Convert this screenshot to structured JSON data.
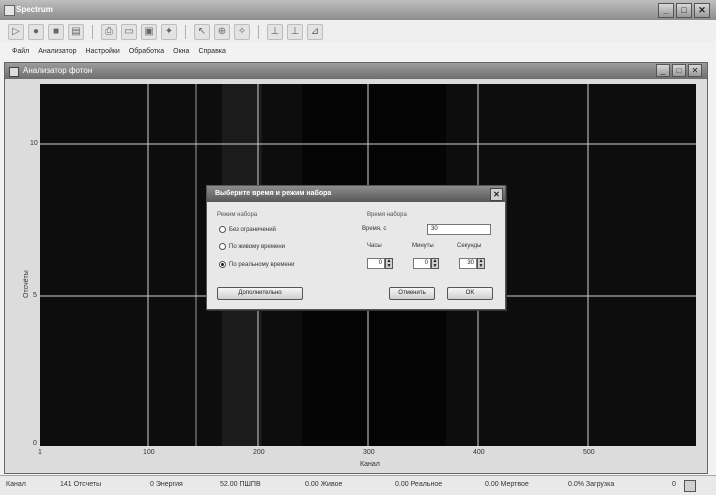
{
  "window": {
    "title": "Spectrum"
  },
  "menu": [
    "Файл",
    "Анализатор",
    "Настройки",
    "Обработка",
    "Окна",
    "Справка"
  ],
  "toolbar_icons": [
    "play-icon",
    "record-icon",
    "stop-icon",
    "save-icon",
    "print-icon",
    "folder-icon",
    "save-file-icon",
    "export-icon",
    "cursor-icon",
    "zoom-icon",
    "settings-icon",
    "marker-left-icon",
    "marker-center-icon",
    "marker-right-icon"
  ],
  "child_window": {
    "title": "Анализатор фотон"
  },
  "plot": {
    "y_ticks": [
      "10",
      "5",
      "0"
    ],
    "x_ticks": [
      "1",
      "100",
      "200",
      "300",
      "400",
      "500"
    ],
    "xlabel": "Канал",
    "ylabel": "Отсчёты"
  },
  "dialog": {
    "title": "Выберите время и режим набора",
    "mode_group": "Режим набора",
    "modes": [
      "Без ограничений",
      "По живому времени",
      "По реальному времени"
    ],
    "selected_mode": "По реальному времени",
    "time_group": "Время набора",
    "time_label": "Время, с",
    "time_value": "30",
    "hours_label": "Часы",
    "minutes_label": "Минуты",
    "seconds_label": "Секунды",
    "hours_value": "0",
    "minutes_value": "0",
    "seconds_value": "30",
    "advanced_button": "Дополнительно",
    "cancel_button": "Отменить",
    "ok_button": "OK"
  },
  "statusbar": {
    "channel": "Канал",
    "counts": "141 Отсчеты",
    "energy": "0 Энергия",
    "fwhm": "52.00 ПШПВ",
    "live": "0.00 Живое",
    "real": "0.00 Реальное",
    "dead": "0.00 Мертвое",
    "load": "0.0% Загрузка",
    "page": "0"
  }
}
